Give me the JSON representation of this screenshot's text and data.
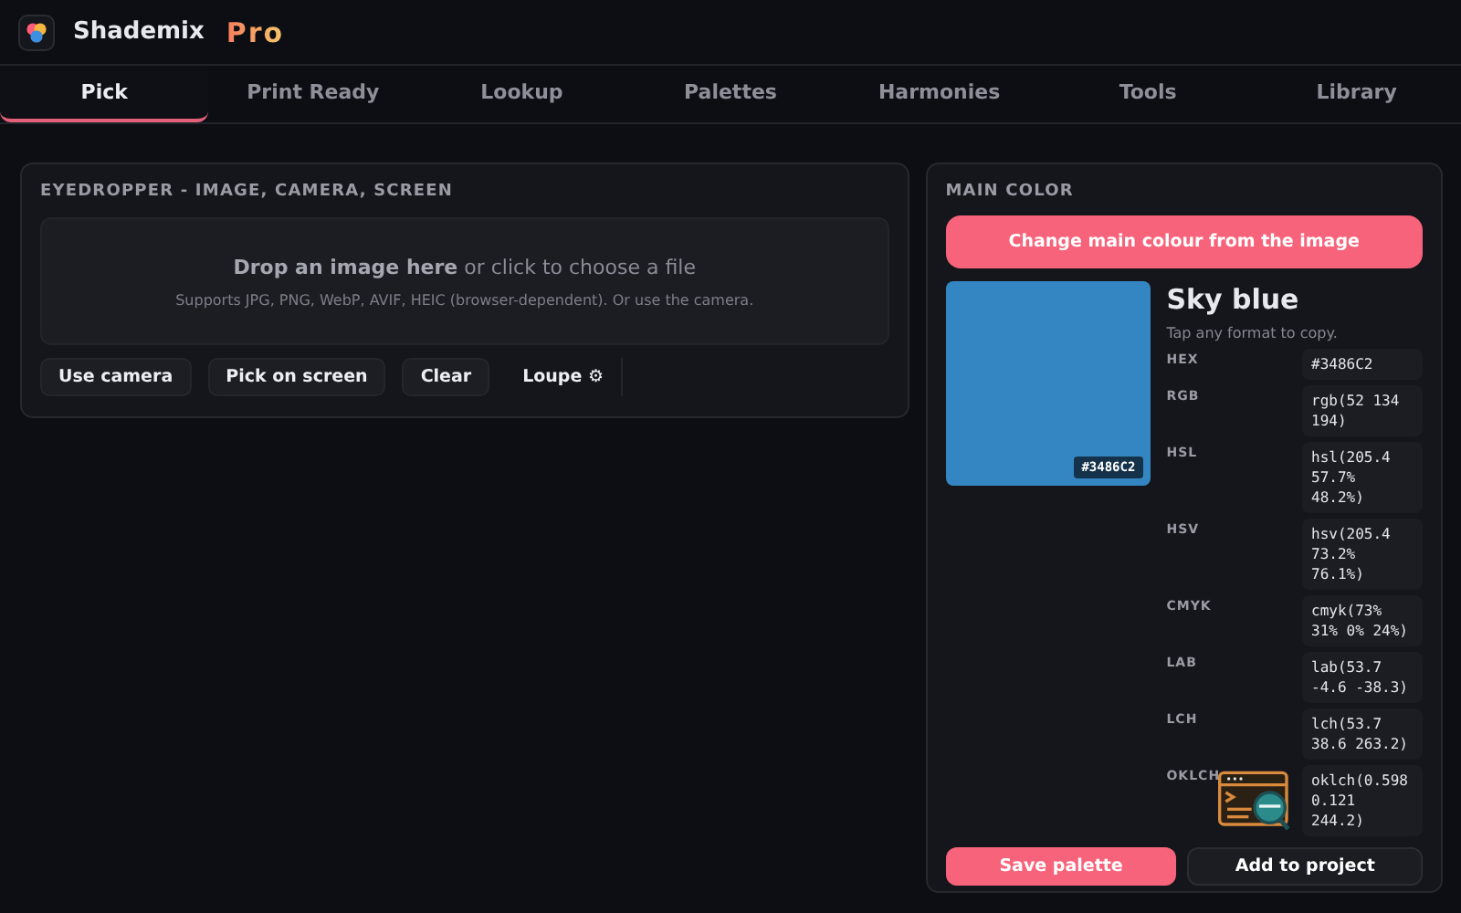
{
  "app": {
    "name": "Shademix",
    "badge": "Pro"
  },
  "tabs": [
    {
      "label": "Pick",
      "selected": true
    },
    {
      "label": "Print Ready",
      "selected": false
    },
    {
      "label": "Lookup",
      "selected": false
    },
    {
      "label": "Palettes",
      "selected": false
    },
    {
      "label": "Harmonies",
      "selected": false
    },
    {
      "label": "Tools",
      "selected": false
    },
    {
      "label": "Library",
      "selected": false
    }
  ],
  "eyedropper": {
    "title": "EYEDROPPER - IMAGE, CAMERA, SCREEN",
    "drop_text": "**Drop an image here** or click to choose a file",
    "drop_hint": "Supports JPG, PNG, WebP, AVIF, HEIC (browser-dependent). Or use the camera.",
    "buttons": [
      {
        "label": "Use camera",
        "kind": "button"
      },
      {
        "label": "Pick on screen",
        "kind": "button"
      },
      {
        "label": "Clear",
        "kind": "button"
      },
      {
        "label": "Loupe ⚙",
        "kind": "toggle"
      }
    ]
  },
  "main_color": {
    "title": "MAIN COLOR",
    "change_button": "Change main colour from the image",
    "color": "#3486c2",
    "swatch_label": "#3486C2",
    "name": "Sky blue",
    "hint": "Tap any format to copy.",
    "formats": [
      {
        "label": "HEX",
        "value": "#3486C2"
      },
      {
        "label": "RGB",
        "value": "rgb(52 134 194)"
      },
      {
        "label": "HSL",
        "value": "hsl(205.4 57.7% 48.2%)"
      },
      {
        "label": "HSV",
        "value": "hsv(205.4 73.2% 76.1%)"
      },
      {
        "label": "CMYK",
        "value": "cmyk(73% 31% 0% 24%)"
      },
      {
        "label": "LAB",
        "value": "lab(53.7 -4.6 -38.3)"
      },
      {
        "label": "LCH",
        "value": "lch(53.7 38.6 263.2)"
      },
      {
        "label": "OKLCH",
        "value": "oklch(0.598 0.121 244.2)"
      }
    ],
    "actions": [
      {
        "label": "Save palette",
        "kind": "primary"
      },
      {
        "label": "Add to project",
        "kind": "secondary"
      }
    ]
  }
}
